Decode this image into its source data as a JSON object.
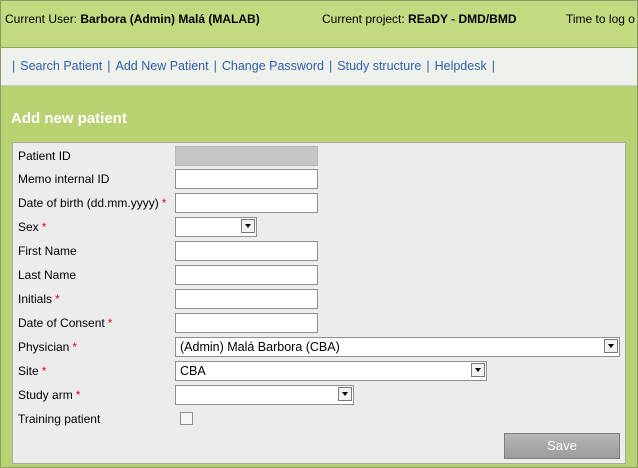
{
  "header": {
    "current_user_label": "Current User:",
    "current_user_value": "Barbora (Admin) Malá (MALAB)",
    "current_project_label": "Current project:",
    "current_project_value": "REaDY - DMD/BMD",
    "time_to_logout": "Time to log o"
  },
  "nav": {
    "items": [
      "Search Patient",
      "Add New Patient",
      "Change Password",
      "Study structure",
      "Helpdesk"
    ],
    "separator": "|"
  },
  "page": {
    "title": "Add new patient"
  },
  "form": {
    "required_mark": "*",
    "fields": {
      "patient_id": "Patient ID",
      "memo_id": "Memo internal ID",
      "dob": "Date of birth (dd.mm.yyyy)",
      "sex": "Sex",
      "first_name": "First Name",
      "last_name": "Last Name",
      "initials": "Initials",
      "consent": "Date of Consent",
      "physician": "Physician",
      "site": "Site",
      "study_arm": "Study arm",
      "training": "Training patient"
    },
    "values": {
      "sex": "",
      "physician": "(Admin) Malá Barbora (CBA)",
      "site": "CBA",
      "study_arm": ""
    },
    "save_label": "Save"
  }
}
